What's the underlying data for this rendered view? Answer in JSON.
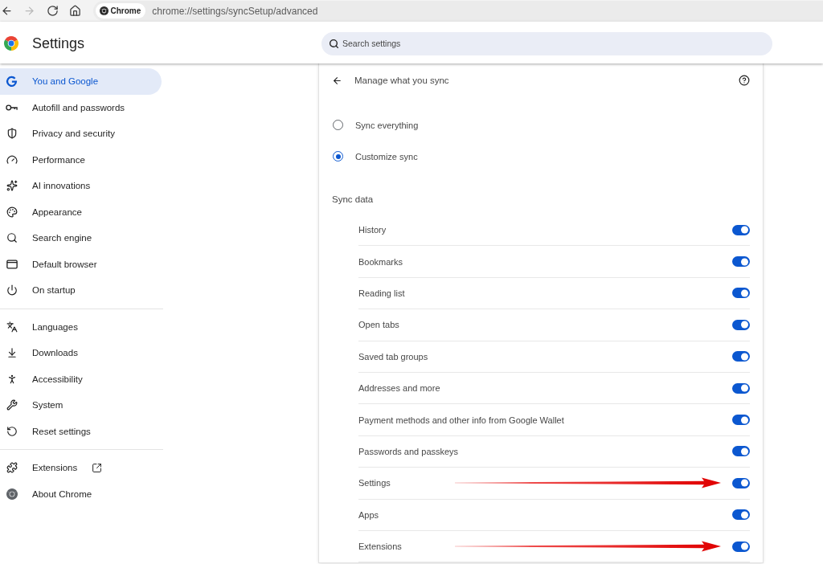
{
  "browser": {
    "nav_buttons": [
      {
        "kind": "back",
        "disabled": false
      },
      {
        "kind": "forward",
        "disabled": true
      },
      {
        "kind": "reload",
        "disabled": false
      },
      {
        "kind": "home",
        "disabled": false
      }
    ],
    "address_bar": {
      "chip": "Chrome",
      "url": "chrome://settings/syncSetup/advanced"
    }
  },
  "header": {
    "title": "Settings",
    "search": {
      "placeholder": "Search settings"
    }
  },
  "sidebar": {
    "groups": [
      {
        "items": [
          {
            "label": "You and Google",
            "selected": true
          },
          {
            "label": "Autofill and passwords",
            "selected": false
          },
          {
            "label": "Privacy and security",
            "selected": false
          },
          {
            "label": "Performance",
            "selected": false
          },
          {
            "label": "AI innovations",
            "selected": false
          },
          {
            "label": "Appearance",
            "selected": false
          },
          {
            "label": "Search engine",
            "selected": false
          },
          {
            "label": "Default browser",
            "selected": false
          },
          {
            "label": "On startup",
            "selected": false
          }
        ]
      },
      {
        "items": [
          {
            "label": "Languages",
            "selected": false
          },
          {
            "label": "Downloads",
            "selected": false
          },
          {
            "label": "Accessibility",
            "selected": false
          },
          {
            "label": "System",
            "selected": false
          },
          {
            "label": "Reset settings",
            "selected": false
          }
        ]
      },
      {
        "items": [
          {
            "label": "Extensions",
            "selected": false
          },
          {
            "label": "About Chrome",
            "selected": false
          }
        ]
      }
    ]
  },
  "panel": {
    "title": "Manage what you sync",
    "sync_options": [
      {
        "label": "Sync everything",
        "selected": false
      },
      {
        "label": "Customize sync",
        "selected": true
      }
    ],
    "sync_data": {
      "heading": "Sync data",
      "items": [
        {
          "label": "History",
          "on": true,
          "annotated": false
        },
        {
          "label": "Bookmarks",
          "on": true,
          "annotated": false
        },
        {
          "label": "Reading list",
          "on": true,
          "annotated": false
        },
        {
          "label": "Open tabs",
          "on": true,
          "annotated": false
        },
        {
          "label": "Saved tab groups",
          "on": true,
          "annotated": false
        },
        {
          "label": "Addresses and more",
          "on": true,
          "annotated": false
        },
        {
          "label": "Payment methods and other info from Google Wallet",
          "on": true,
          "annotated": false
        },
        {
          "label": "Passwords and passkeys",
          "on": true,
          "annotated": false
        },
        {
          "label": "Settings",
          "on": true,
          "annotated": true
        },
        {
          "label": "Apps",
          "on": true,
          "annotated": false
        },
        {
          "label": "Extensions",
          "on": true,
          "annotated": true
        }
      ]
    }
  }
}
